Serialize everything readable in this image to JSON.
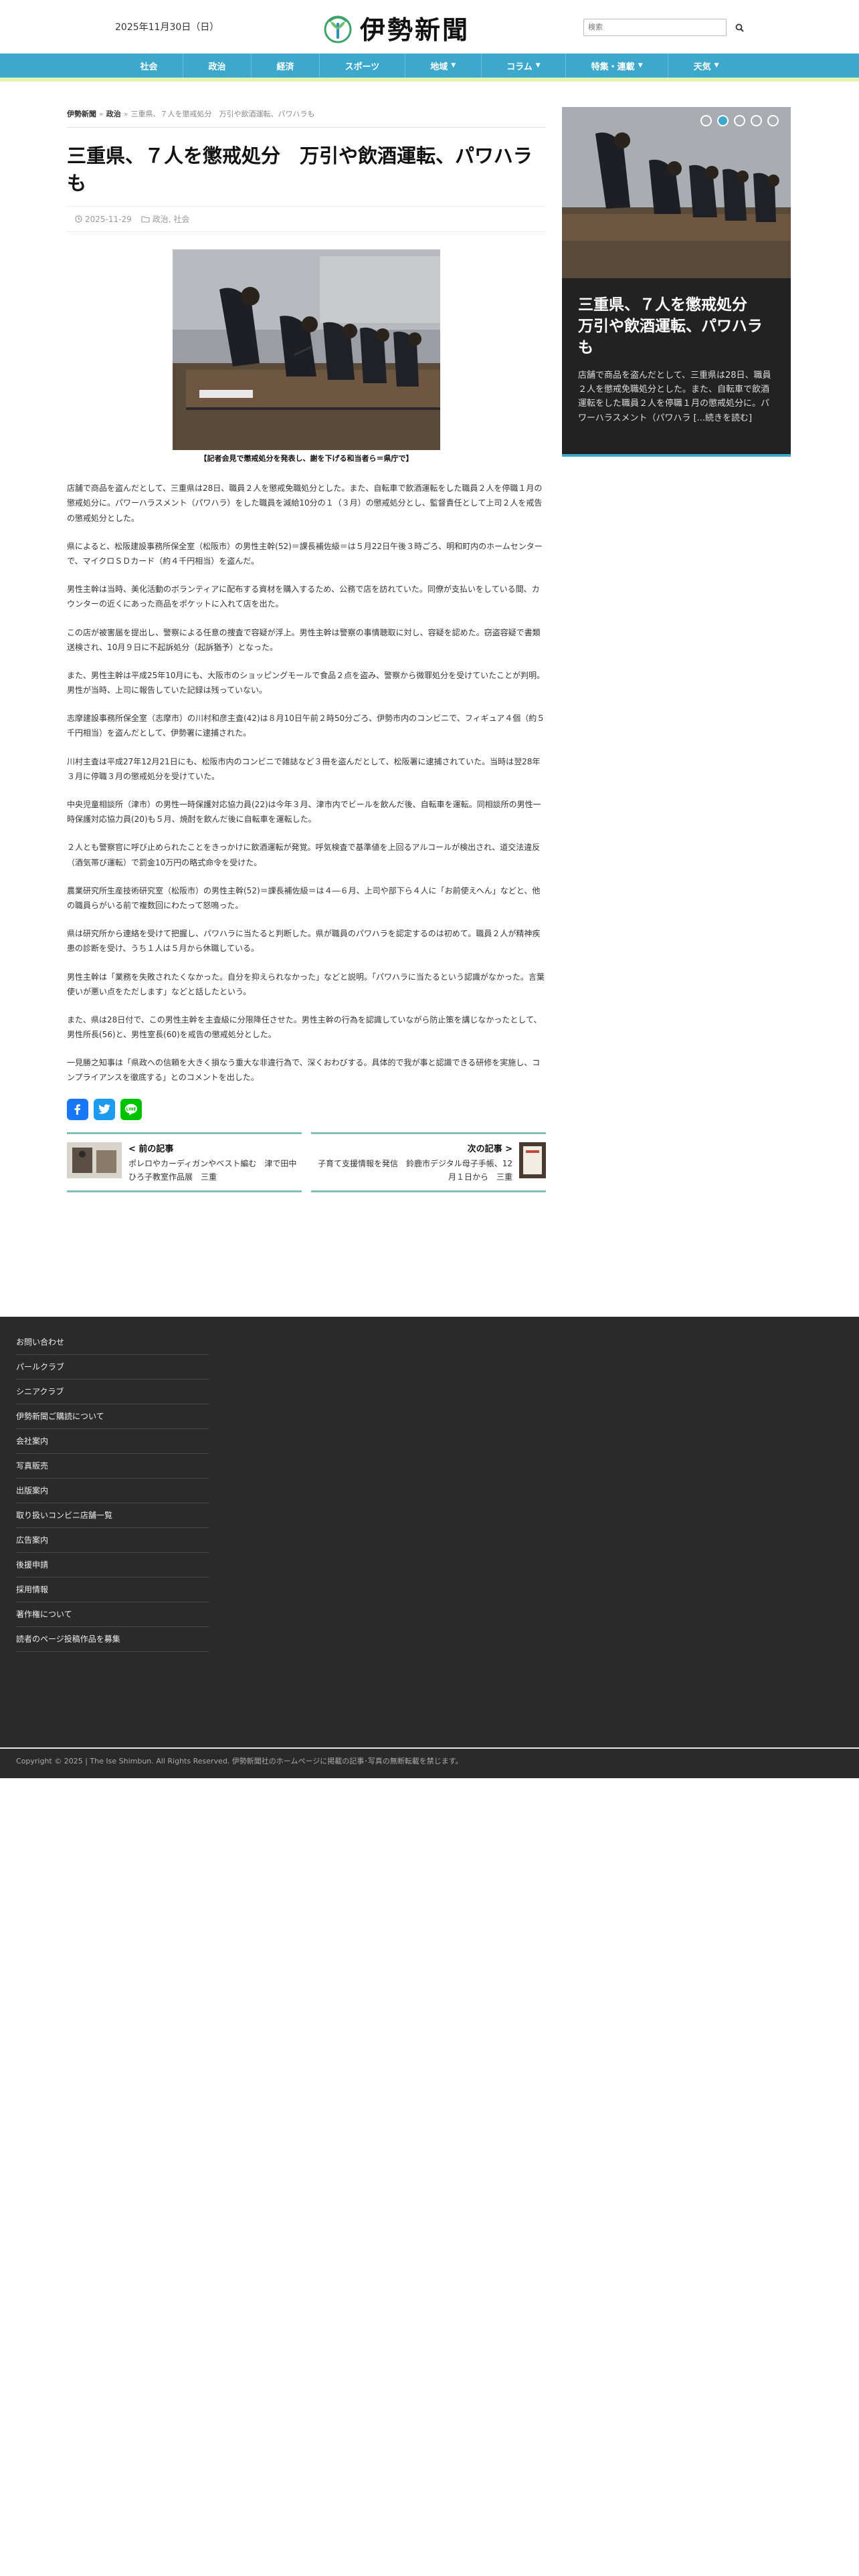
{
  "header": {
    "date": "2025年11月30日（日）",
    "logo_text": "伊勢新聞",
    "search_placeholder": "検索"
  },
  "nav": [
    {
      "label": "社会",
      "dropdown": false
    },
    {
      "label": "政治",
      "dropdown": false
    },
    {
      "label": "経済",
      "dropdown": false
    },
    {
      "label": "スポーツ",
      "dropdown": false
    },
    {
      "label": "地域",
      "dropdown": true
    },
    {
      "label": "コラム",
      "dropdown": true
    },
    {
      "label": "特集・連載",
      "dropdown": true
    },
    {
      "label": "天気",
      "dropdown": true
    }
  ],
  "breadcrumb": {
    "home": "伊勢新聞",
    "category": "政治",
    "current": "三重県、７人を懲戒処分　万引や飲酒運転、パワハラも"
  },
  "article": {
    "title": "三重県、７人を懲戒処分　万引や飲酒運転、パワハラも",
    "date": "2025-11-29",
    "categories": "政治, 社会",
    "caption": "【記者会見で懲戒処分を発表し、謝を下げる和当者ら＝県庁で】",
    "paragraphs": [
      "店舗で商品を盗んだとして、三重県は28日、職員２人を懲戒免職処分とした。また、自転車で飲酒運転をした職員２人を停職１月の懲戒処分に。パワーハラスメント（パワハラ）をした職員を減給10分の１（３月）の懲戒処分とし、監督責任として上司２人を戒告の懲戒処分とした。",
      "県によると、松阪建設事務所保全室（松阪市）の男性主幹(52)＝課長補佐級＝は５月22日午後３時ごろ、明和町内のホームセンターで、マイクロＳＤカード（約４千円相当）を盗んだ。",
      "男性主幹は当時、美化活動のボランティアに配布する資材を購入するため、公務で店を訪れていた。同僚が支払いをしている間、カウンターの近くにあった商品をポケットに入れて店を出た。",
      "この店が被害届を提出し、警察による任意の捜査で容疑が浮上。男性主幹は警察の事情聴取に対し、容疑を認めた。窃盗容疑で書類送検され、10月９日に不起訴処分（起訴猶予）となった。",
      "また、男性主幹は平成25年10月にも、大阪市のショッピングモールで食品２点を盗み、警察から微罪処分を受けていたことが判明。男性が当時、上司に報告していた記録は残っていない。",
      "志摩建設事務所保全室（志摩市）の川村和彦主査(42)は８月10日午前２時50分ごろ、伊勢市内のコンビニで、フィギュア４個（約５千円相当）を盗んだとして、伊勢署に逮捕された。",
      "川村主査は平成27年12月21日にも、松阪市内のコンビニで雑誌など３冊を盗んだとして、松阪署に逮捕されていた。当時は翌28年３月に停職３月の懲戒処分を受けていた。",
      "中央児童相談所（津市）の男性一時保護対応協力員(22)は今年３月、津市内でビールを飲んだ後、自転車を運転。同相談所の男性一時保護対応協力員(20)も５月、焼酎を飲んだ後に自転車を運転した。",
      "２人とも警察官に呼び止められたことをきっかけに飲酒運転が発覚。呼気検査で基準値を上回るアルコールが検出され、道交法違反（酒気帯び運転）で罰金10万円の略式命令を受けた。",
      "農業研究所生産技術研究室（松阪市）の男性主幹(52)＝課長補佐級＝は４―６月、上司や部下ら４人に「お前使えへん」などと、他の職員らがいる前で複数回にわたって怒鳴った。",
      "県は研究所から連絡を受けて把握し、パワハラに当たると判断した。県が職員のパワハラを認定するのは初めて。職員２人が精神疾患の診断を受け、うち１人は５月から休職している。",
      "男性主幹は「業務を失敗されたくなかった。自分を抑えられなかった」などと説明。「パワハラに当たるという認識がなかった。言葉使いが悪い点をただします」などと話したという。",
      "また、県は28日付で、この男性主幹を主査級に分限降任させた。男性主幹の行為を認識していながら防止策を講じなかったとして、男性所長(56)と、男性室長(60)を戒告の懲戒処分とした。",
      "一見勝之知事は「県政への信頼を大きく損なう重大な非違行為で、深くおわびする。具体的で我が事と認識できる研修を実施し、コンプライアンスを徹底する」とのコメントを出した。"
    ]
  },
  "share": [
    {
      "name": "Facebook",
      "color": "#1877f2"
    },
    {
      "name": "Twitter",
      "color": "#1d9bf0"
    },
    {
      "name": "Line",
      "color": "#00c300"
    }
  ],
  "post_nav": {
    "prev_label": "< 前の記事",
    "prev_title": "ポレロやカーディガンやベスト編む　津で田中ひろ子教室作品展　三重",
    "next_label": "次の記事 >",
    "next_title": "子育て支援情報を発信　鈴鹿市デジタル母子手帳、12月１日から　三重"
  },
  "slider": {
    "title": "三重県、７人を懲戒処分　万引や飲酒運転、パワハラも",
    "excerpt": "店舗で商品を盗んだとして、三重県は28日、職員２人を懲戒免職処分とした。また、自転車で飲酒運転をした職員２人を停職１月の懲戒処分に。パワーハラスメント（パワハラ [...続きを読む]",
    "dots": 5,
    "active_dot": 2
  },
  "footer": {
    "links": [
      "お問い合わせ",
      "パールクラブ",
      "シニアクラブ",
      "伊勢新聞ご購読について",
      "会社案内",
      "写真販売",
      "出版案内",
      "取り扱いコンビニ店舗一覧",
      "広告案内",
      "後援申請",
      "採用情報",
      "著作権について",
      "読者のページ投稿作品を募集"
    ],
    "copyright": "Copyright © 2025 | The Ise Shimbun. All Rights Reserved. 伊勢新聞社のホームページに掲載の記事･写真の無断転載を禁じます。"
  },
  "colors": {
    "nav_bg": "#3ba8cc",
    "nav_border": "#e4f4b0",
    "post_nav_border": "#7fc2b4",
    "footer_bg": "#2a2a2a"
  }
}
